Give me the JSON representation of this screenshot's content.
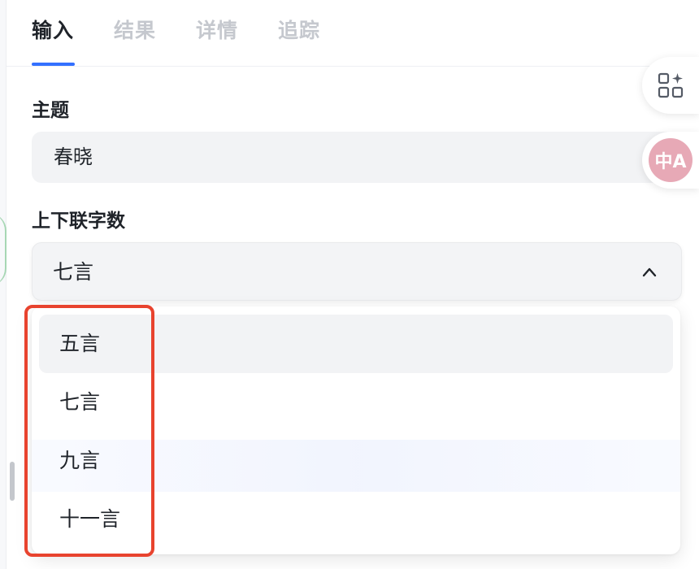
{
  "tabs": [
    {
      "label": "输入",
      "active": true
    },
    {
      "label": "结果",
      "active": false
    },
    {
      "label": "详情",
      "active": false
    },
    {
      "label": "追踪",
      "active": false
    }
  ],
  "form": {
    "topic_label": "主题",
    "topic_value": "春晓",
    "count_label": "上下联字数",
    "count_selected": "七言"
  },
  "dropdown": {
    "options": [
      "五言",
      "七言",
      "九言",
      "十一言"
    ],
    "hovered_index": 0
  },
  "side_tools": {
    "apps_icon": "apps-sparkle-icon",
    "translate_icon": "translate-icon",
    "translate_glyph": "中A"
  },
  "colors": {
    "accent": "#3370ff",
    "highlight": "#e8432e",
    "translate_bg": "#e7a9b6"
  }
}
